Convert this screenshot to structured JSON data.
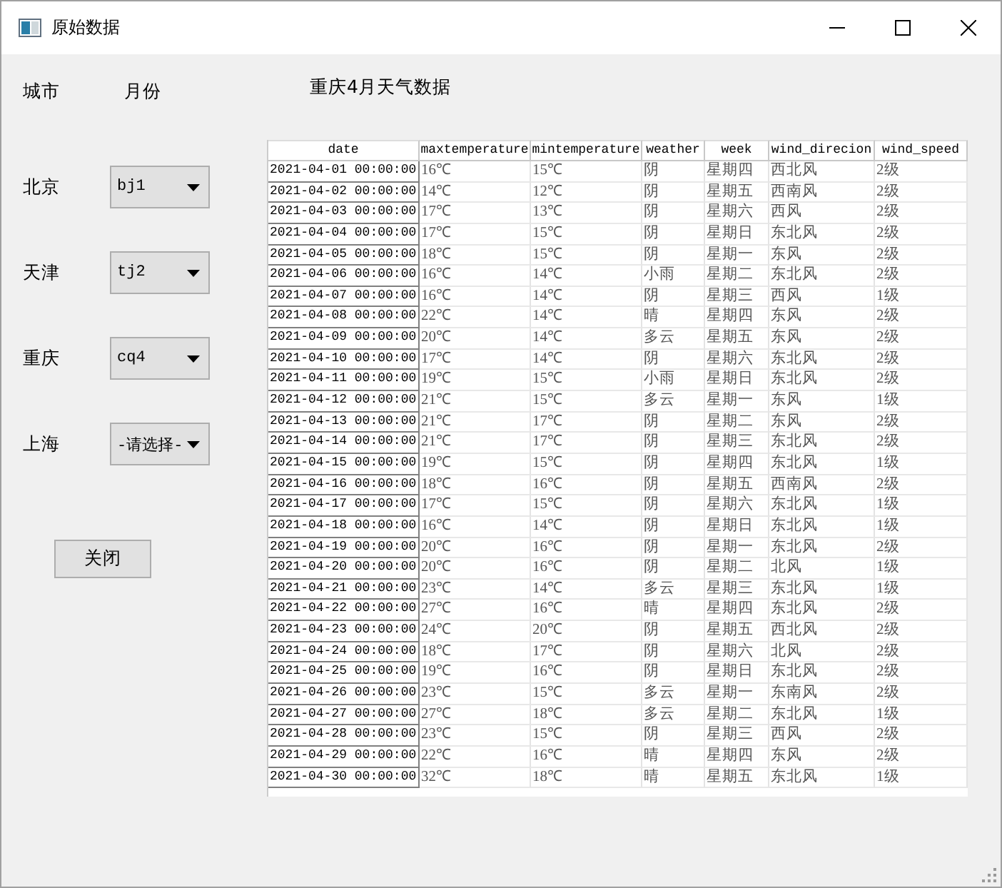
{
  "window": {
    "title": "原始数据"
  },
  "header_labels": [
    "城市",
    "月份"
  ],
  "table_title": "重庆4月天气数据",
  "cities": [
    {
      "label": "北京",
      "value": "bj1"
    },
    {
      "label": "天津",
      "value": "tj2"
    },
    {
      "label": "重庆",
      "value": "cq4"
    },
    {
      "label": "上海",
      "value": "-请选择-"
    }
  ],
  "close_button": "关闭",
  "table": {
    "columns": [
      "date",
      "maxtemperature",
      "mintemperature",
      "weather",
      "week",
      "wind_direcion",
      "wind_speed"
    ],
    "rows": [
      [
        "2021-04-01 00:00:00",
        "16℃",
        "15℃",
        "阴",
        "星期四",
        "西北风",
        "2级"
      ],
      [
        "2021-04-02 00:00:00",
        "14℃",
        "12℃",
        "阴",
        "星期五",
        "西南风",
        "2级"
      ],
      [
        "2021-04-03 00:00:00",
        "17℃",
        "13℃",
        "阴",
        "星期六",
        "西风",
        "2级"
      ],
      [
        "2021-04-04 00:00:00",
        "17℃",
        "15℃",
        "阴",
        "星期日",
        "东北风",
        "2级"
      ],
      [
        "2021-04-05 00:00:00",
        "18℃",
        "15℃",
        "阴",
        "星期一",
        "东风",
        "2级"
      ],
      [
        "2021-04-06 00:00:00",
        "16℃",
        "14℃",
        "小雨",
        "星期二",
        "东北风",
        "2级"
      ],
      [
        "2021-04-07 00:00:00",
        "16℃",
        "14℃",
        "阴",
        "星期三",
        "西风",
        "1级"
      ],
      [
        "2021-04-08 00:00:00",
        "22℃",
        "14℃",
        "晴",
        "星期四",
        "东风",
        "2级"
      ],
      [
        "2021-04-09 00:00:00",
        "20℃",
        "14℃",
        "多云",
        "星期五",
        "东风",
        "2级"
      ],
      [
        "2021-04-10 00:00:00",
        "17℃",
        "14℃",
        "阴",
        "星期六",
        "东北风",
        "2级"
      ],
      [
        "2021-04-11 00:00:00",
        "19℃",
        "15℃",
        "小雨",
        "星期日",
        "东北风",
        "2级"
      ],
      [
        "2021-04-12 00:00:00",
        "21℃",
        "15℃",
        "多云",
        "星期一",
        "东风",
        "1级"
      ],
      [
        "2021-04-13 00:00:00",
        "21℃",
        "17℃",
        "阴",
        "星期二",
        "东风",
        "2级"
      ],
      [
        "2021-04-14 00:00:00",
        "21℃",
        "17℃",
        "阴",
        "星期三",
        "东北风",
        "2级"
      ],
      [
        "2021-04-15 00:00:00",
        "19℃",
        "15℃",
        "阴",
        "星期四",
        "东北风",
        "1级"
      ],
      [
        "2021-04-16 00:00:00",
        "18℃",
        "16℃",
        "阴",
        "星期五",
        "西南风",
        "2级"
      ],
      [
        "2021-04-17 00:00:00",
        "17℃",
        "15℃",
        "阴",
        "星期六",
        "东北风",
        "1级"
      ],
      [
        "2021-04-18 00:00:00",
        "16℃",
        "14℃",
        "阴",
        "星期日",
        "东北风",
        "1级"
      ],
      [
        "2021-04-19 00:00:00",
        "20℃",
        "16℃",
        "阴",
        "星期一",
        "东北风",
        "2级"
      ],
      [
        "2021-04-20 00:00:00",
        "20℃",
        "16℃",
        "阴",
        "星期二",
        "北风",
        "1级"
      ],
      [
        "2021-04-21 00:00:00",
        "23℃",
        "14℃",
        "多云",
        "星期三",
        "东北风",
        "1级"
      ],
      [
        "2021-04-22 00:00:00",
        "27℃",
        "16℃",
        "晴",
        "星期四",
        "东北风",
        "2级"
      ],
      [
        "2021-04-23 00:00:00",
        "24℃",
        "20℃",
        "阴",
        "星期五",
        "西北风",
        "2级"
      ],
      [
        "2021-04-24 00:00:00",
        "18℃",
        "17℃",
        "阴",
        "星期六",
        "北风",
        "2级"
      ],
      [
        "2021-04-25 00:00:00",
        "19℃",
        "16℃",
        "阴",
        "星期日",
        "东北风",
        "2级"
      ],
      [
        "2021-04-26 00:00:00",
        "23℃",
        "15℃",
        "多云",
        "星期一",
        "东南风",
        "2级"
      ],
      [
        "2021-04-27 00:00:00",
        "27℃",
        "18℃",
        "多云",
        "星期二",
        "东北风",
        "1级"
      ],
      [
        "2021-04-28 00:00:00",
        "23℃",
        "15℃",
        "阴",
        "星期三",
        "西风",
        "2级"
      ],
      [
        "2021-04-29 00:00:00",
        "22℃",
        "16℃",
        "晴",
        "星期四",
        "东风",
        "2级"
      ],
      [
        "2021-04-30 00:00:00",
        "32℃",
        "18℃",
        "晴",
        "星期五",
        "东北风",
        "1级"
      ]
    ]
  }
}
